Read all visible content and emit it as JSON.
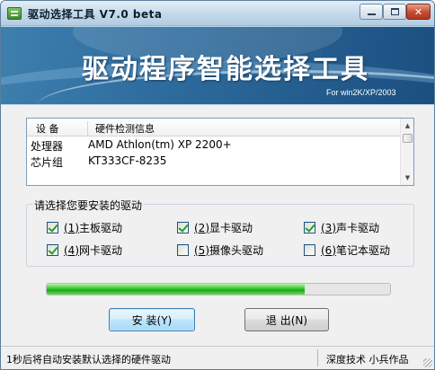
{
  "window": {
    "title": "驱动选择工具 V7.0 beta",
    "controls": {
      "minimize": "",
      "maximize": "",
      "close": "✕"
    }
  },
  "banner": {
    "title": "驱动程序智能选择工具",
    "subtitle": "For win2K/XP/2003"
  },
  "device_list": {
    "columns": [
      "设 备",
      "硬件检测信息"
    ],
    "rows": [
      {
        "device": "处理器",
        "info": "AMD Athlon(tm) XP 2200+"
      },
      {
        "device": "芯片组",
        "info": "KT333CF-8235"
      }
    ],
    "scroll_up": "▲",
    "scroll_down": "▼"
  },
  "driver_group": {
    "title": "请选择您要安装的驱动",
    "options": [
      {
        "key": "(1)",
        "label": "主板驱动",
        "checked": true
      },
      {
        "key": "(2)",
        "label": "显卡驱动",
        "checked": true
      },
      {
        "key": "(3)",
        "label": "声卡驱动",
        "checked": true
      },
      {
        "key": "(4)",
        "label": "网卡驱动",
        "checked": true
      },
      {
        "key": "(5)",
        "label": "摄像头驱动",
        "checked": false
      },
      {
        "key": "(6)",
        "label": "笔记本驱动",
        "checked": false
      }
    ]
  },
  "progress": {
    "value": 0.75,
    "color": "#2fbf24"
  },
  "buttons": {
    "install": "安 装(Y)",
    "exit": "退 出(N)"
  },
  "statusbar": {
    "message": "1秒后将自动安装默认选择的硬件驱动",
    "credit": "深度技术  小兵作品"
  },
  "colors": {
    "banner": "#2d6b9c",
    "check": "#21a121"
  }
}
